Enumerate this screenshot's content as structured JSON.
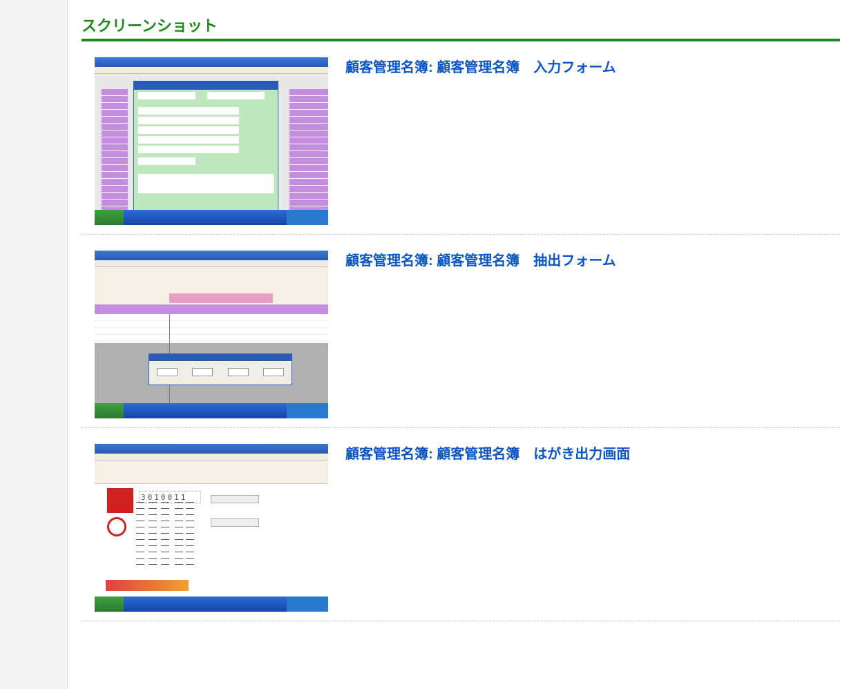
{
  "section_title": "スクリーンショット",
  "screenshots": [
    {
      "title": "顧客管理名簿: 顧客管理名簿　入力フォーム"
    },
    {
      "title": "顧客管理名簿: 顧客管理名簿　抽出フォーム"
    },
    {
      "title": "顧客管理名簿: 顧客管理名簿　はがき出力画面"
    }
  ],
  "postal_placeholder": "3010011"
}
